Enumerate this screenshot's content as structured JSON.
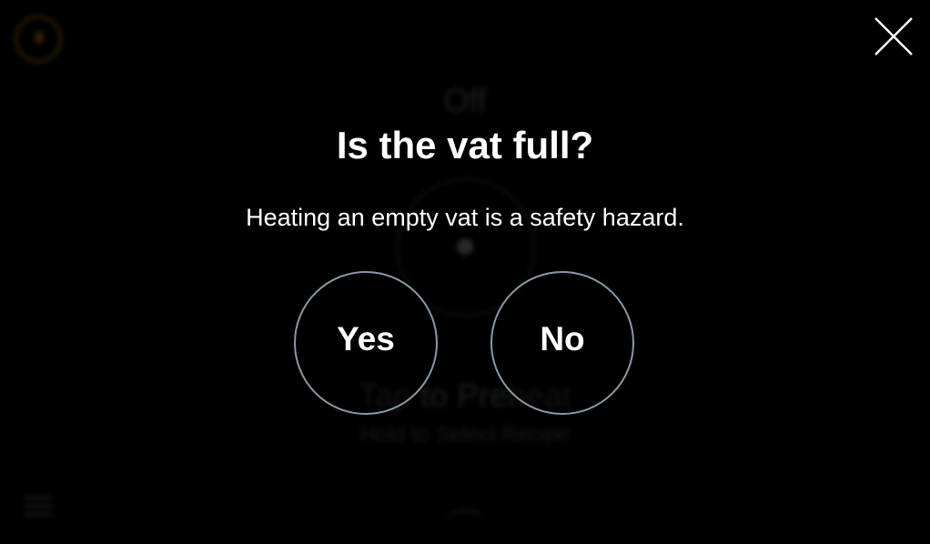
{
  "background": {
    "state_label": "Off",
    "primary_hint": "Tap to Preheat",
    "secondary_hint": "Hold to Select Recipe",
    "icons": {
      "top_left": "drop-icon",
      "bottom_left": "list-icon",
      "bottom_center": "chevron-up-icon"
    }
  },
  "dialog": {
    "title": "Is the vat full?",
    "message": "Heating an empty vat is a safety hazard.",
    "confirm_label": "Yes",
    "cancel_label": "No",
    "close_icon": "close-icon"
  },
  "colors": {
    "background": "#000000",
    "text": "#ffffff",
    "button_border": "#8a9aa2",
    "accent_amber": "#5a4300"
  }
}
